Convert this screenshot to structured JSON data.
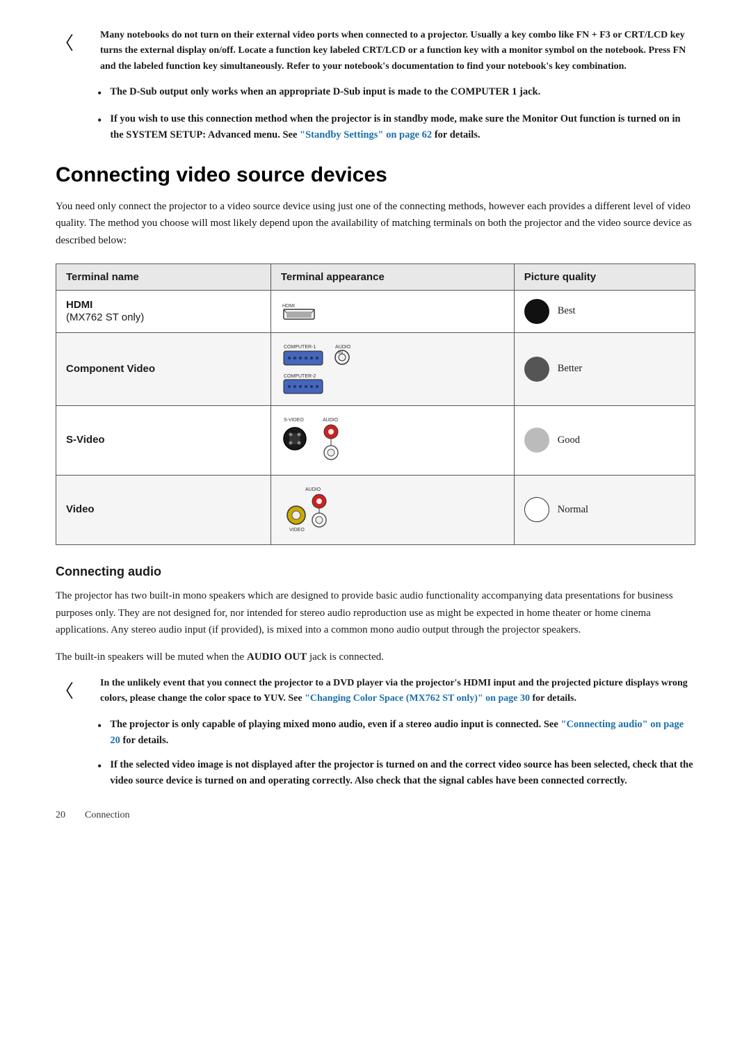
{
  "notes": {
    "note1": {
      "text": "Many notebooks do not turn on their external video ports when connected to a projector. Usually a key combo like FN + F3 or CRT/LCD key turns the external display on/off. Locate a function key labeled CRT/LCD or a function key with a monitor symbol on the notebook. Press FN and the labeled function key simultaneously. Refer to your notebook's documentation to find your notebook's key combination."
    },
    "bullet1": {
      "text": "The D-Sub output only works when an appropriate D-Sub input is made to the COMPUTER 1 jack."
    },
    "bullet2_pre": "If you wish to use this connection method when the projector is in standby mode, make sure the Monitor Out function is turned on in the SYSTEM SETUP: Advanced menu. See ",
    "bullet2_link": "\"Standby Settings\" on page 62",
    "bullet2_post": " for details."
  },
  "section": {
    "title": "Connecting video source devices",
    "intro": "You need only connect the projector to a video source device using just one of the connecting methods, however each provides a different level of video quality. The method you choose will most likely depend upon the availability of matching terminals on both the projector and the video source device as described below:"
  },
  "table": {
    "headers": [
      "Terminal name",
      "Terminal appearance",
      "Picture quality"
    ],
    "rows": [
      {
        "name": "HDMI",
        "sub": "(MX762 ST only)",
        "quality_label": "Best",
        "quality_type": "best"
      },
      {
        "name": "Component Video",
        "sub": "",
        "quality_label": "Better",
        "quality_type": "better"
      },
      {
        "name": "S-Video",
        "sub": "",
        "quality_label": "Good",
        "quality_type": "good"
      },
      {
        "name": "Video",
        "sub": "",
        "quality_label": "Normal",
        "quality_type": "normal"
      }
    ]
  },
  "audio_section": {
    "title": "Connecting audio",
    "para1": "The projector has two built-in mono speakers which are designed to provide basic audio functionality accompanying data presentations for business purposes only. They are not designed for, nor intended for stereo audio reproduction use as might be expected in home theater or home cinema applications. Any stereo audio input (if provided), is mixed into a common mono audio output through the projector speakers.",
    "para2_pre": "The built-in speakers will be muted when the ",
    "para2_bold": "AUDIO OUT",
    "para2_post": " jack is connected."
  },
  "notes2": {
    "note1_pre": "In the unlikely event that you connect the projector to a DVD player via the projector's HDMI input and the projected picture displays wrong colors, please change the color space to YUV. See ",
    "note1_link": "\"Changing Color Space (MX762 ST only)\" on page 30",
    "note1_post": " for details.",
    "bullet1_pre": "The projector is only capable of playing mixed mono audio, even if a stereo audio input is connected. See ",
    "bullet1_link": "\"Connecting audio\" on page 20",
    "bullet1_post": " for details.",
    "bullet2": "If the selected video image is not displayed after the projector is turned on and the correct video source has been selected, check that the video source device is turned on and operating correctly. Also check that the signal cables have been connected correctly."
  },
  "footer": {
    "page": "20",
    "section": "Connection"
  }
}
